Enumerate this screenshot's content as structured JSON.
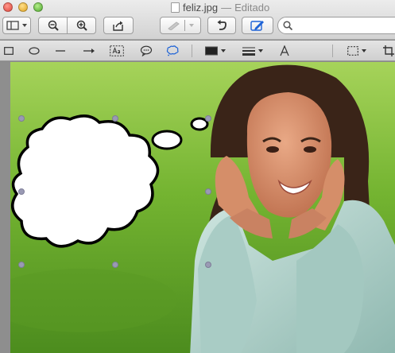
{
  "window": {
    "filename": "feliz.jpg",
    "separator": "—",
    "status": "Editado"
  },
  "toolbar": {
    "view_icon": "sidebar-view-icon",
    "zoom_out_icon": "zoom-out-icon",
    "zoom_in_icon": "zoom-in-icon",
    "share_icon": "share-icon",
    "rotate_icon": "rotate-icon",
    "markup_icon": "markup-pen-icon",
    "search_placeholder": ""
  },
  "annotation_tools": [
    "rectangle-icon",
    "oval-icon",
    "line-icon",
    "arrow-icon",
    "text-box-icon",
    "speech-bubble-icon",
    "thought-bubble-icon",
    "border-color-icon",
    "line-style-icon",
    "font-icon",
    "selection-icon",
    "crop-icon"
  ],
  "colors": {
    "accent": "#1e63d6",
    "grass": "#6cab2e",
    "handle": "#9a9ab4"
  }
}
